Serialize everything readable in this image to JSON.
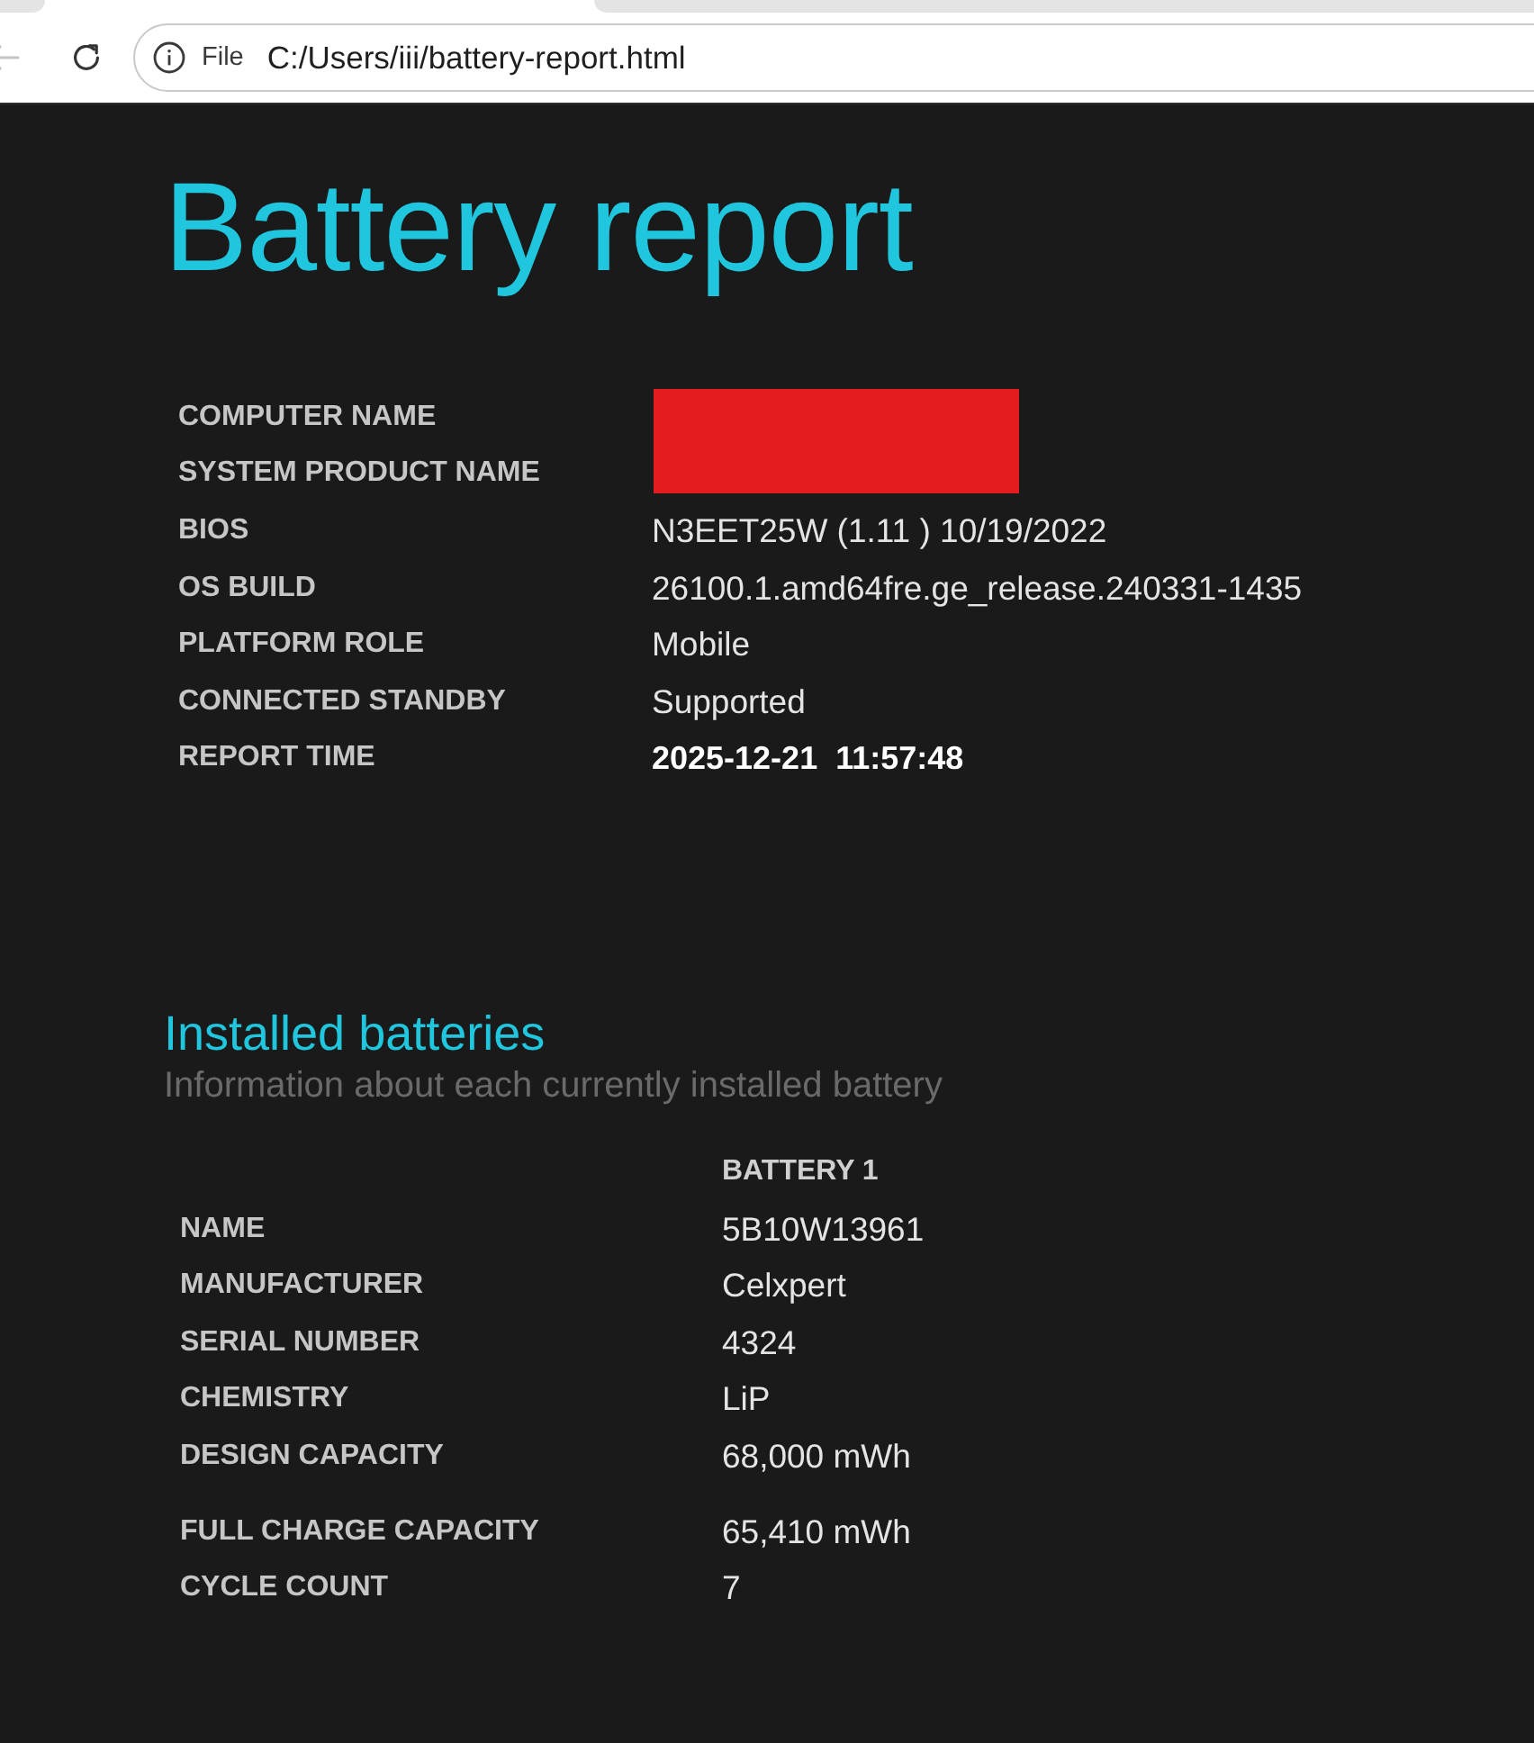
{
  "browser": {
    "back_button": {
      "disabled": true
    },
    "address_bar": {
      "scheme_label": "File",
      "url": "C:/Users/iii/battery-report.html"
    }
  },
  "report": {
    "title": "Battery report",
    "system_info": [
      {
        "label": "COMPUTER NAME",
        "kind": "redacted"
      },
      {
        "label": "SYSTEM PRODUCT NAME",
        "kind": "redacted"
      },
      {
        "label": "BIOS",
        "value": "N3EET25W (1.11 ) 10/19/2022",
        "kind": "text"
      },
      {
        "label": "OS BUILD",
        "value": "26100.1.amd64fre.ge_release.240331-1435",
        "kind": "text"
      },
      {
        "label": "PLATFORM ROLE",
        "value": "Mobile",
        "kind": "text"
      },
      {
        "label": "CONNECTED STANDBY",
        "value": "Supported",
        "kind": "text"
      },
      {
        "label": "REPORT TIME",
        "value": "2025-12-21  11:57:48",
        "kind": "timestamp"
      }
    ]
  },
  "installed_batteries": {
    "title": "Installed batteries",
    "subtitle": "Information about each currently installed battery",
    "columns": [
      "BATTERY 1"
    ],
    "row_groups": [
      {
        "rows": [
          {
            "label": "NAME",
            "values": [
              "5B10W13961"
            ]
          },
          {
            "label": "MANUFACTURER",
            "values": [
              "Celxpert"
            ]
          },
          {
            "label": "SERIAL NUMBER",
            "values": [
              "4324"
            ]
          },
          {
            "label": "CHEMISTRY",
            "values": [
              "LiP"
            ]
          },
          {
            "label": "DESIGN CAPACITY",
            "values": [
              "68,000 mWh"
            ]
          }
        ]
      },
      {
        "rows": [
          {
            "label": "FULL CHARGE CAPACITY",
            "values": [
              "65,410 mWh"
            ]
          },
          {
            "label": "CYCLE COUNT",
            "values": [
              "7"
            ]
          }
        ]
      }
    ]
  }
}
